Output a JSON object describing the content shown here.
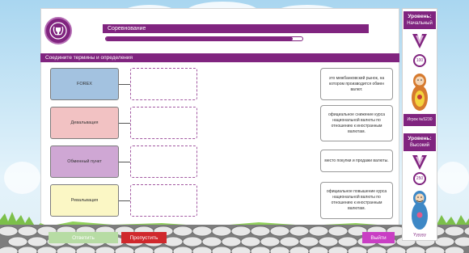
{
  "header": {
    "title": "Соревнование",
    "progress_percent": 95
  },
  "task": {
    "instruction": "Соедините термины и определения"
  },
  "terms": [
    {
      "label": "FOREX",
      "color": "#a3c2e0"
    },
    {
      "label": "Девальвация",
      "color": "#f2c2c3"
    },
    {
      "label": "Обменный пункт",
      "color": "#cfa7d4"
    },
    {
      "label": "Ревальвация",
      "color": "#fbf7c5"
    }
  ],
  "definitions": [
    "это межбанковский рынок, на котором производится обмен валют.",
    "официальное снижение курса национальной валюты по отношению к иностранным валютам.",
    "место покупки и продажи валюты.",
    "официальное повышение курса национальной валюты по отношению к иностранным валютам."
  ],
  "buttons": {
    "answer": "Ответить",
    "skip": "Пропустить",
    "exit": "Выйти"
  },
  "sidebar": {
    "current_level_title": "Уровень:",
    "current_level_value": "Начальный",
    "current_score": "100",
    "player_label": "Игрок №5230",
    "target_level_title": "Уровень:",
    "target_level_value": "Высокий",
    "target_score": "250",
    "user_name": "Yyyyyy"
  },
  "colors": {
    "accent": "#80247f",
    "answer_button": "#b7dca4",
    "skip_button": "#d0282c",
    "exit_button": "#c93ec4"
  }
}
